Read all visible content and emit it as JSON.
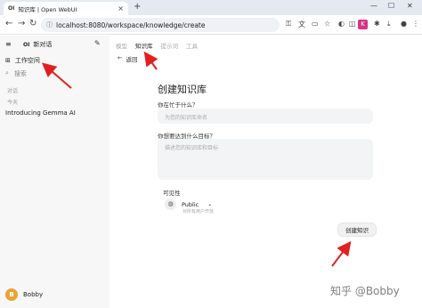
{
  "browser": {
    "tab_favicon": "OI",
    "tab_title": "知识库 | Open WebUI",
    "url": "localhost:8080/workspace/knowledge/create"
  },
  "sidebar": {
    "new_chat_label": "新对话",
    "workspace_label": "工作空间",
    "search_placeholder": "搜索",
    "section_chats": "对话",
    "section_today": "今天",
    "chat_items": [
      "Introducing Gemma AI"
    ],
    "user": {
      "initial": "B",
      "name": "Bobby"
    }
  },
  "main": {
    "tabs": [
      "模型",
      "知识库",
      "提示词",
      "工具"
    ],
    "active_tab": "知识库",
    "back_label": "返回",
    "form": {
      "title": "创建知识库",
      "what_label": "你在忙于什么？",
      "what_placeholder": "为您的知识库命名",
      "goal_label": "你想要达到什么目标？",
      "goal_placeholder": "描述您的知识库和目标",
      "visibility_label": "可见性",
      "visibility_value": "Public",
      "visibility_desc": "对所有用户开放",
      "create_button": "创建知识"
    }
  },
  "watermark": "知乎 @Bobby",
  "colors": {
    "annotation_red": "#e02020",
    "avatar": "#e8a33a",
    "ext_pink": "#d63384"
  },
  "icons": [
    "sidebar-toggle-icon",
    "openwebui-logo-icon",
    "edit-icon",
    "workspace-grid-icon",
    "search-icon",
    "back-arrow-icon",
    "globe-icon",
    "chevron-down-icon",
    "lock-icon"
  ]
}
